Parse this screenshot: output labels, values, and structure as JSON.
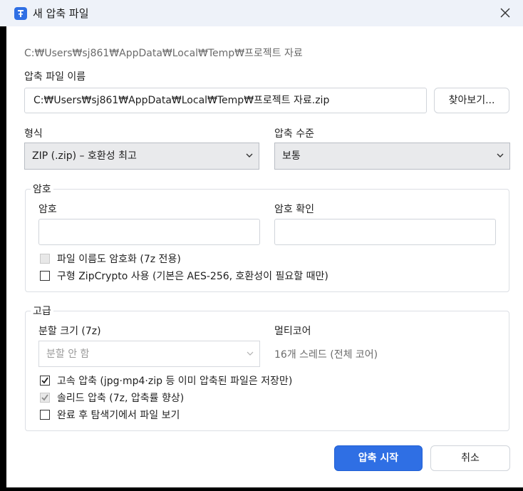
{
  "window": {
    "title": "새 압축 파일",
    "icon": "archive-app-icon",
    "close_icon": "close-icon"
  },
  "target_path": "C:₩Users₩sj861₩AppData₩Local₩Temp₩프로젝트 자료",
  "archive_name": {
    "label": "압축 파일 이름",
    "value": "C:₩Users₩sj861₩AppData₩Local₩Temp₩프로젝트 자료.zip",
    "browse_label": "찾아보기..."
  },
  "format": {
    "label": "형식",
    "selected": "ZIP (.zip) – 호환성 최고"
  },
  "compression_level": {
    "label": "압축 수준",
    "selected": "보통"
  },
  "password": {
    "group_title": "암호",
    "password_label": "암호",
    "password_value": "",
    "confirm_label": "암호 확인",
    "confirm_value": "",
    "encrypt_names_label": "파일 이름도 암호화 (7z 전용)",
    "encrypt_names_checked": false,
    "legacy_zipcrypto_label": "구형 ZipCrypto 사용 (기본은 AES-256, 호환성이 필요할 때만)",
    "legacy_zipcrypto_checked": false
  },
  "advanced": {
    "group_title": "고급",
    "split_label": "분할 크기 (7z)",
    "split_selected": "분할 안 함",
    "multicore_label": "멀티코어",
    "multicore_value": "16개 스레드 (전체 코어)",
    "fast_compress_label": "고속 압축 (jpg·mp4·zip 등 이미 압축된 파일은 저장만)",
    "fast_compress_checked": true,
    "solid_label": "솔리드 압축 (7z, 압축률 향상)",
    "solid_checked": true,
    "open_after_label": "완료 후 탐색기에서 파일 보기",
    "open_after_checked": false
  },
  "buttons": {
    "start_label": "압축 시작",
    "cancel_label": "취소"
  },
  "colors": {
    "accent": "#2f6fe4",
    "titlebar": "#eef2f9"
  }
}
